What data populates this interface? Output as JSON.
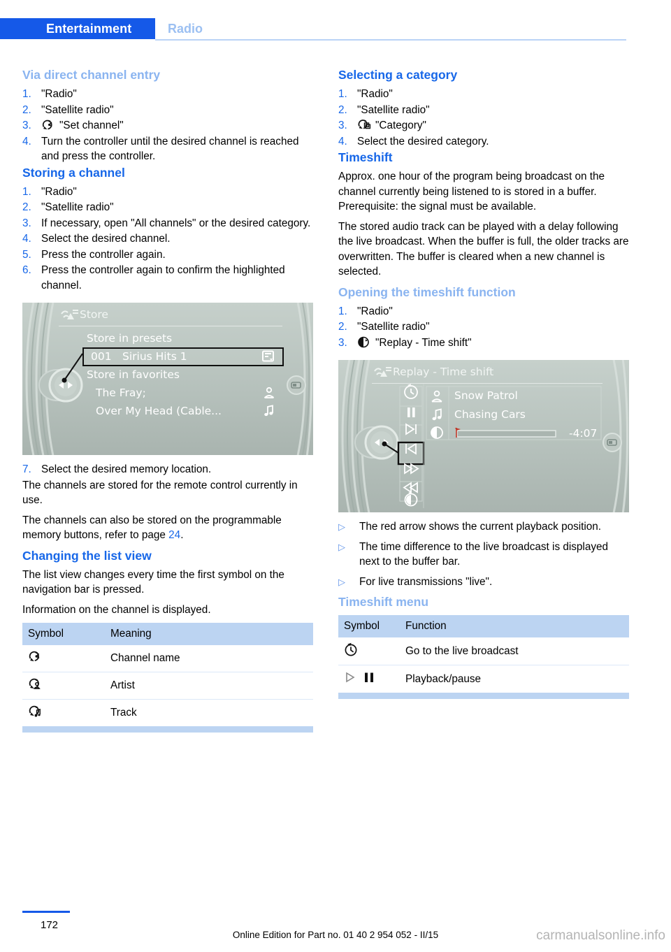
{
  "header": {
    "tab_label": "Entertainment",
    "section_label": "Radio"
  },
  "left_column": {
    "h_direct_entry": "Via direct channel entry",
    "direct_entry_steps": [
      {
        "num": "1.",
        "text": "\"Radio\""
      },
      {
        "num": "2.",
        "text": "\"Satellite radio\""
      },
      {
        "num": "3.",
        "text": "\"Set channel\"",
        "icon": "set-channel-icon"
      },
      {
        "num": "4.",
        "text": "Turn the controller until the desired channel is reached and press the controller."
      }
    ],
    "h_storing": "Storing a channel",
    "storing_steps": [
      {
        "num": "1.",
        "text": "\"Radio\""
      },
      {
        "num": "2.",
        "text": "\"Satellite radio\""
      },
      {
        "num": "3.",
        "text": "If necessary, open \"All channels\" or the desired category."
      },
      {
        "num": "4.",
        "text": "Select the desired channel."
      },
      {
        "num": "5.",
        "text": "Press the controller again."
      },
      {
        "num": "6.",
        "text": "Press the controller again to confirm the highlighted channel."
      }
    ],
    "store_screen": {
      "title": "Store",
      "group_presets": "Store in presets",
      "preset_number": "001",
      "preset_name": "Sirius Hits 1",
      "group_favorites": "Store in favorites",
      "favorite_artist": "The Fray;",
      "favorite_track": "Over My Head (Cable..."
    },
    "step7": {
      "num": "7.",
      "text": "Select the desired memory location."
    },
    "para_remote": "The channels are stored for the remote control currently in use.",
    "para_memory_pre": "The channels can also be stored on the programmable memory buttons, refer to page ",
    "para_memory_link": "24",
    "para_memory_post": ".",
    "h_list_view": "Changing the list view",
    "para_list_view": "The list view changes every time the first symbol on the navigation bar is pressed.",
    "para_info": "Information on the channel is displayed.",
    "symbol_table": {
      "columns": [
        "Symbol",
        "Meaning"
      ],
      "rows": [
        {
          "icon": "cycle-channel-icon",
          "meaning": "Channel name"
        },
        {
          "icon": "cycle-artist-icon",
          "meaning": "Artist"
        },
        {
          "icon": "cycle-track-icon",
          "meaning": "Track"
        }
      ]
    }
  },
  "right_column": {
    "h_category": "Selecting a category",
    "category_steps": [
      {
        "num": "1.",
        "text": "\"Radio\""
      },
      {
        "num": "2.",
        "text": "\"Satellite radio\""
      },
      {
        "num": "3.",
        "text": "\"Category\"",
        "icon": "cycle-category-icon"
      },
      {
        "num": "4.",
        "text": "Select the desired category."
      }
    ],
    "h_timeshift": "Timeshift",
    "para_timeshift_1": "Approx. one hour of the program being broadcast on the channel currently being listened to is stored in a buffer. Prerequisite: the signal must be available.",
    "para_timeshift_2": "The stored audio track can be played with a delay following the live broadcast. When the buffer is full, the older tracks are overwritten. The buffer is cleared when a new channel is selected.",
    "h_opening": "Opening the timeshift function",
    "opening_steps": [
      {
        "num": "1.",
        "text": "\"Radio\""
      },
      {
        "num": "2.",
        "text": "\"Satellite radio\""
      },
      {
        "num": "3.",
        "text": "\"Replay - Time shift\"",
        "icon": "replay-icon"
      }
    ],
    "replay_screen": {
      "title": "Replay - Time shift",
      "artist": "Snow Patrol",
      "track": "Chasing Cars",
      "time_remaining": "-4:07"
    },
    "bullets": [
      "The red arrow shows the current playback position.",
      "The time difference to the live broadcast is displayed next to the buffer bar.",
      "For live transmissions \"live\"."
    ],
    "h_timeshift_menu": "Timeshift menu",
    "menu_table": {
      "columns": [
        "Symbol",
        "Function"
      ],
      "rows": [
        {
          "icon": "live-clock-icon",
          "function": "Go to the live broadcast"
        },
        {
          "icon": "play-pause-icon",
          "function": "Playback/pause"
        }
      ]
    }
  },
  "footer": {
    "page_number": "172",
    "edition_text": "Online Edition for Part no. 01 40 2 954 052 - II/15",
    "watermark": "carmanualsonline.info"
  },
  "colors": {
    "tab_blue": "#1559e8",
    "heading_light_blue": "#8ab4f0",
    "heading_dark_blue": "#1767e8",
    "table_header_blue": "#bcd4f2",
    "link_blue": "#1767e8"
  }
}
